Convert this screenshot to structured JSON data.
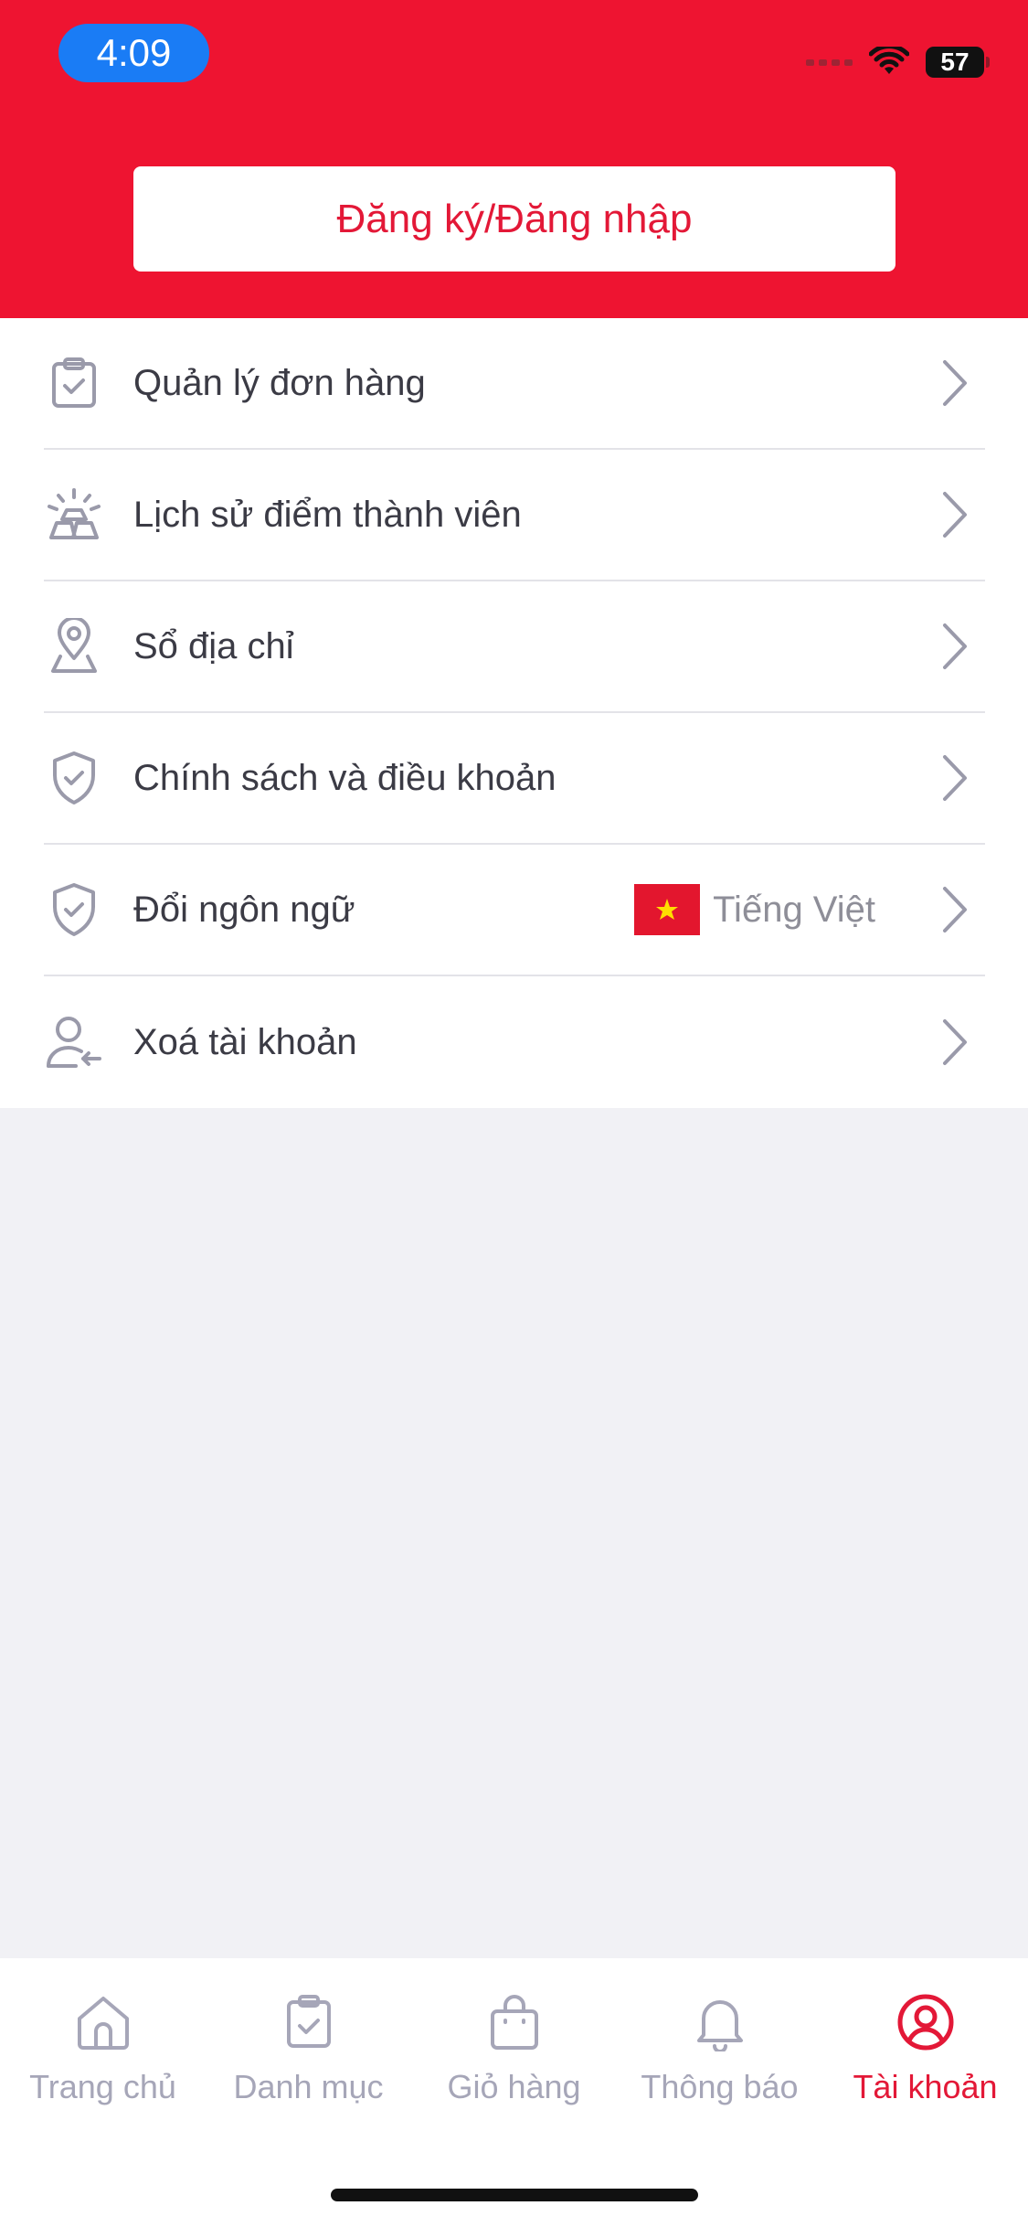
{
  "status_bar": {
    "time": "4:09",
    "battery": "57"
  },
  "header": {
    "login_label": "Đăng ký/Đăng nhập"
  },
  "menu": {
    "items": [
      {
        "label": "Quản lý đơn hàng",
        "icon": "clipboard-check-icon"
      },
      {
        "label": "Lịch sử điểm thành viên",
        "icon": "gold-bar-icon"
      },
      {
        "label": "Sổ địa chỉ",
        "icon": "location-pin-icon"
      },
      {
        "label": "Chính sách và điều khoản",
        "icon": "shield-check-icon"
      },
      {
        "label": "Đổi ngôn ngữ",
        "icon": "shield-check-icon",
        "value": "Tiếng Việt"
      },
      {
        "label": "Xoá tài khoản",
        "icon": "user-remove-icon"
      }
    ]
  },
  "tabbar": {
    "tabs": [
      {
        "label": "Trang chủ",
        "icon": "home-icon"
      },
      {
        "label": "Danh mục",
        "icon": "clipboard-check-icon"
      },
      {
        "label": "Giỏ hàng",
        "icon": "shopping-bag-icon"
      },
      {
        "label": "Thông báo",
        "icon": "bell-icon"
      },
      {
        "label": "Tài khoản",
        "icon": "user-circle-icon",
        "active": true
      }
    ]
  },
  "colors": {
    "brand_red": "#ee1431",
    "active_tab": "#e31837",
    "inactive_tab": "#a6a6b8",
    "icon_gray": "#9a9aaa",
    "background": "#f1f1f5"
  }
}
